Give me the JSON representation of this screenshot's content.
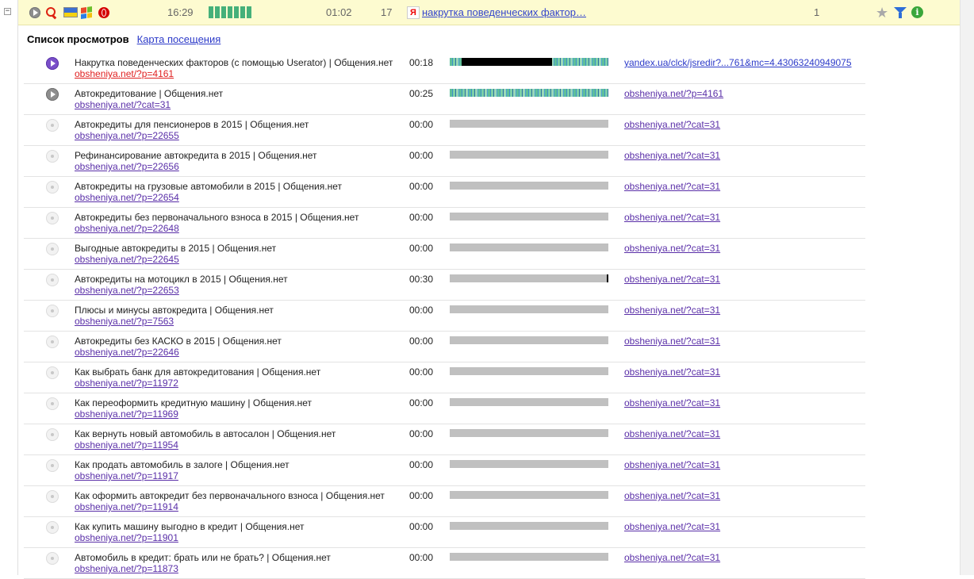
{
  "colors": {
    "topbar_bg": "#fdfbd0",
    "activity": "#45b07a",
    "link_blue": "#2d3bc9",
    "link_visited": "#5a2fa8",
    "link_active": "#e02020",
    "bar_idle": "#c0c0c0"
  },
  "topbar": {
    "collapse_symbol": "−",
    "icons": [
      "play-icon",
      "search-icon",
      "ukraine-flag-icon",
      "windows-icon",
      "opera-icon"
    ],
    "time": "16:29",
    "duration": "01:02",
    "pages": "17",
    "referrer_icon_letter": "Я",
    "referrer_text": "накрутка поведенческих фактор…",
    "visits": "1"
  },
  "section": {
    "title": "Список просмотров",
    "map_link": "Карта посещения"
  },
  "rows": [
    {
      "status": "playing",
      "title": "Накрутка поведенческих факторов (с помощью Userator) | Общения.нет",
      "url": "obsheniya.net/?p=4161",
      "time": "00:18",
      "bar": "striped",
      "fill_start": 0.075,
      "fill_end": 0.645,
      "ref": "yandex.ua/clck/jsredir?...761&mc=4.43063240949075"
    },
    {
      "status": "visited",
      "title": "Автокредитование | Общения.нет",
      "url": "obsheniya.net/?cat=31",
      "time": "00:25",
      "bar": "striped",
      "ref": "obsheniya.net/?p=4161"
    },
    {
      "status": "pending",
      "title": "Автокредиты для пенсионеров в 2015 | Общения.нет",
      "url": "obsheniya.net/?p=22655",
      "time": "00:00",
      "bar": "idle",
      "ref": "obsheniya.net/?cat=31"
    },
    {
      "status": "pending",
      "title": "Рефинансирование автокредита в 2015 | Общения.нет",
      "url": "obsheniya.net/?p=22656",
      "time": "00:00",
      "bar": "idle",
      "ref": "obsheniya.net/?cat=31"
    },
    {
      "status": "pending",
      "title": "Автокредиты на грузовые автомобили в 2015 | Общения.нет",
      "url": "obsheniya.net/?p=22654",
      "time": "00:00",
      "bar": "idle",
      "ref": "obsheniya.net/?cat=31"
    },
    {
      "status": "pending",
      "title": "Автокредиты без первоначального взноса в 2015 | Общения.нет",
      "url": "obsheniya.net/?p=22648",
      "time": "00:00",
      "bar": "idle",
      "ref": "obsheniya.net/?cat=31"
    },
    {
      "status": "pending",
      "title": "Выгодные автокредиты в 2015 | Общения.нет",
      "url": "obsheniya.net/?p=22645",
      "time": "00:00",
      "bar": "idle",
      "ref": "obsheniya.net/?cat=31"
    },
    {
      "status": "pending",
      "title": "Автокредиты на мотоцикл в 2015 | Общения.нет",
      "url": "obsheniya.net/?p=22653",
      "time": "00:30",
      "bar": "idle",
      "mark": 0.995,
      "ref": "obsheniya.net/?cat=31"
    },
    {
      "status": "pending",
      "title": "Плюсы и минусы автокредита | Общения.нет",
      "url": "obsheniya.net/?p=7563",
      "time": "00:00",
      "bar": "idle",
      "ref": "obsheniya.net/?cat=31"
    },
    {
      "status": "pending",
      "title": "Автокредиты без КАСКО в 2015 | Общения.нет",
      "url": "obsheniya.net/?p=22646",
      "time": "00:00",
      "bar": "idle",
      "ref": "obsheniya.net/?cat=31"
    },
    {
      "status": "pending",
      "title": "Как выбрать банк для автокредитования | Общения.нет",
      "url": "obsheniya.net/?p=11972",
      "time": "00:00",
      "bar": "idle",
      "ref": "obsheniya.net/?cat=31"
    },
    {
      "status": "pending",
      "title": "Как переоформить кредитную машину | Общения.нет",
      "url": "obsheniya.net/?p=11969",
      "time": "00:00",
      "bar": "idle",
      "ref": "obsheniya.net/?cat=31"
    },
    {
      "status": "pending",
      "title": "Как вернуть новый автомобиль в автосалон | Общения.нет",
      "url": "obsheniya.net/?p=11954",
      "time": "00:00",
      "bar": "idle",
      "ref": "obsheniya.net/?cat=31"
    },
    {
      "status": "pending",
      "title": "Как продать автомобиль в залоге | Общения.нет",
      "url": "obsheniya.net/?p=11917",
      "time": "00:00",
      "bar": "idle",
      "ref": "obsheniya.net/?cat=31"
    },
    {
      "status": "pending",
      "title": "Как оформить автокредит без первоначального взноса | Общения.нет",
      "url": "obsheniya.net/?p=11914",
      "time": "00:00",
      "bar": "idle",
      "ref": "obsheniya.net/?cat=31"
    },
    {
      "status": "pending",
      "title": "Как купить машину выгодно в кредит | Общения.нет",
      "url": "obsheniya.net/?p=11901",
      "time": "00:00",
      "bar": "idle",
      "ref": "obsheniya.net/?cat=31"
    },
    {
      "status": "pending",
      "title": "Автомобиль в кредит: брать или не брать? | Общения.нет",
      "url": "obsheniya.net/?p=11873",
      "time": "00:00",
      "bar": "idle",
      "ref": "obsheniya.net/?cat=31"
    }
  ]
}
